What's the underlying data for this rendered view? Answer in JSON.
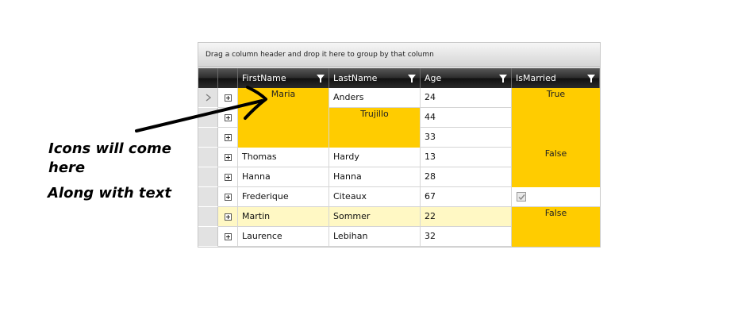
{
  "group_panel_text": "Drag a column header and drop it here to group by that column",
  "columns": [
    {
      "label": "FirstName"
    },
    {
      "label": "LastName"
    },
    {
      "label": "Age"
    },
    {
      "label": "IsMarried"
    }
  ],
  "rows": [
    {
      "first": "",
      "last": "Anders",
      "age": "24"
    },
    {
      "first": "",
      "last": "",
      "age": "44"
    },
    {
      "first": "",
      "last": "",
      "age": "33"
    },
    {
      "first": "Thomas",
      "last": "Hardy",
      "age": "13"
    },
    {
      "first": "Hanna",
      "last": "Hanna",
      "age": "28"
    },
    {
      "first": "Frederique",
      "last": "Citeaux",
      "age": "67"
    },
    {
      "first": "Martin",
      "last": "Sommer",
      "age": "22"
    },
    {
      "first": "Laurence",
      "last": "Lebihan",
      "age": "32"
    }
  ],
  "merged": {
    "first_1": "Maria",
    "last_1": "Trujillo",
    "married_1": "True",
    "married_2": "False",
    "married_3": "False"
  },
  "frederique_married_checked": true,
  "colors": {
    "highlight": "#ffcc00",
    "selected_row": "#fff8c4",
    "header_dark": "#1a1a1a"
  },
  "annotation": {
    "line1": "Icons will come",
    "line2": "here",
    "line3": "Along with text"
  }
}
